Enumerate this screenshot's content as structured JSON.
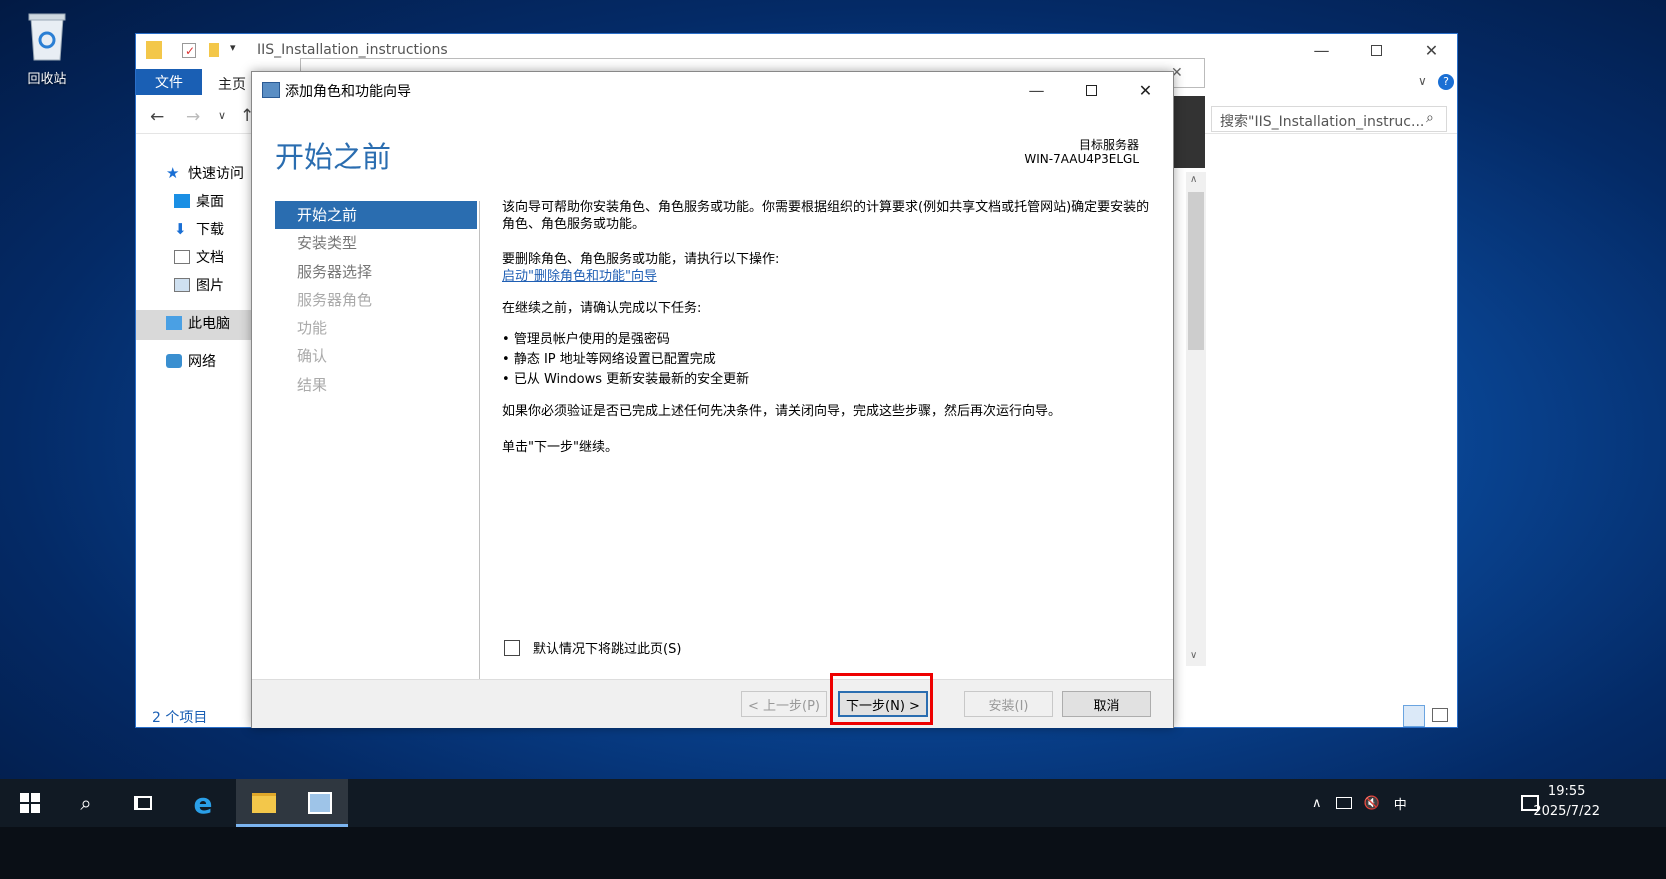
{
  "desktop": {
    "recycle_bin_label": "回收站"
  },
  "explorer": {
    "title": "IIS_Installation_instructions",
    "tab_file": "文件",
    "tab_home": "主页",
    "search_placeholder": "搜索\"IIS_Installation_instruc...",
    "sidebar": [
      {
        "label": "快速访问",
        "icon": "star-icon"
      },
      {
        "label": "桌面",
        "icon": "desktop-icon"
      },
      {
        "label": "下载",
        "icon": "download-icon"
      },
      {
        "label": "文档",
        "icon": "documents-icon"
      },
      {
        "label": "图片",
        "icon": "pictures-icon"
      },
      {
        "label": "此电脑",
        "icon": "computer-icon"
      },
      {
        "label": "网络",
        "icon": "network-icon"
      }
    ],
    "status": "2 个项目"
  },
  "wizard": {
    "title": "添加角色和功能向导",
    "heading": "开始之前",
    "target_label": "目标服务器",
    "target_server": "WIN-7AAU4P3ELGL",
    "steps": [
      {
        "label": "开始之前",
        "state": "active"
      },
      {
        "label": "安装类型",
        "state": "enabled"
      },
      {
        "label": "服务器选择",
        "state": "enabled"
      },
      {
        "label": "服务器角色",
        "state": "disabled"
      },
      {
        "label": "功能",
        "state": "disabled"
      },
      {
        "label": "确认",
        "state": "disabled"
      },
      {
        "label": "结果",
        "state": "disabled"
      }
    ],
    "intro": "该向导可帮助你安装角色、角色服务或功能。你需要根据组织的计算要求(例如共享文档或托管网站)确定要安装的角色、角色服务或功能。",
    "remove_intro": "要删除角色、角色服务或功能，请执行以下操作:",
    "remove_link": "启动\"删除角色和功能\"向导",
    "before_continue": "在继续之前，请确认完成以下任务:",
    "bullets": [
      "管理员帐户使用的是强密码",
      "静态 IP 地址等网络设置已配置完成",
      "已从 Windows 更新安装最新的安全更新"
    ],
    "verify_note": "如果你必须验证是否已完成上述任何先决条件，请关闭向导，完成这些步骤，然后再次运行向导。",
    "continue_note": "单击\"下一步\"继续。",
    "skip_checkbox": "默认情况下将跳过此页(S)",
    "buttons": {
      "prev": "< 上一步(P)",
      "next": "下一步(N) >",
      "install": "安装(I)",
      "cancel": "取消"
    }
  },
  "taskbar": {
    "time": "19:55",
    "date": "2025/7/22",
    "ime": "中"
  }
}
